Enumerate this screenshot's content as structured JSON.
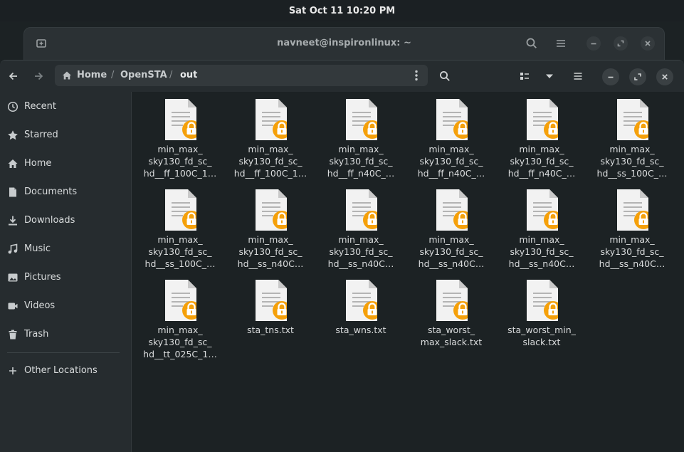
{
  "topbar": {
    "clock": "Sat Oct 11  10:20 PM"
  },
  "terminal": {
    "title": "navneet@inspironlinux: ~"
  },
  "pathbar": {
    "segments": [
      "Home",
      "OpenSTA",
      "out"
    ],
    "separator": "/"
  },
  "sidebar": {
    "items": [
      {
        "label": "Recent",
        "icon": "clock-icon"
      },
      {
        "label": "Starred",
        "icon": "star-icon"
      },
      {
        "label": "Home",
        "icon": "home-icon"
      },
      {
        "label": "Documents",
        "icon": "document-icon"
      },
      {
        "label": "Downloads",
        "icon": "download-icon"
      },
      {
        "label": "Music",
        "icon": "music-icon"
      },
      {
        "label": "Pictures",
        "icon": "picture-icon"
      },
      {
        "label": "Videos",
        "icon": "video-icon"
      },
      {
        "label": "Trash",
        "icon": "trash-icon"
      }
    ],
    "other_locations": "Other Locations"
  },
  "files": [
    {
      "lines": [
        "min_max_",
        "sky130_fd_sc_",
        "hd__ff_100C_1…"
      ]
    },
    {
      "lines": [
        "min_max_",
        "sky130_fd_sc_",
        "hd__ff_100C_1…"
      ]
    },
    {
      "lines": [
        "min_max_",
        "sky130_fd_sc_",
        "hd__ff_n40C_…"
      ]
    },
    {
      "lines": [
        "min_max_",
        "sky130_fd_sc_",
        "hd__ff_n40C_…"
      ]
    },
    {
      "lines": [
        "min_max_",
        "sky130_fd_sc_",
        "hd__ff_n40C_…"
      ]
    },
    {
      "lines": [
        "min_max_",
        "sky130_fd_sc_",
        "hd__ss_100C_…"
      ]
    },
    {
      "lines": [
        "min_max_",
        "sky130_fd_sc_",
        "hd__ss_100C_…"
      ]
    },
    {
      "lines": [
        "min_max_",
        "sky130_fd_sc_",
        "hd__ss_n40C…"
      ]
    },
    {
      "lines": [
        "min_max_",
        "sky130_fd_sc_",
        "hd__ss_n40C…"
      ]
    },
    {
      "lines": [
        "min_max_",
        "sky130_fd_sc_",
        "hd__ss_n40C…"
      ]
    },
    {
      "lines": [
        "min_max_",
        "sky130_fd_sc_",
        "hd__ss_n40C…"
      ]
    },
    {
      "lines": [
        "min_max_",
        "sky130_fd_sc_",
        "hd__ss_n40C…"
      ]
    },
    {
      "lines": [
        "min_max_",
        "sky130_fd_sc_",
        "hd__tt_025C_1…"
      ]
    },
    {
      "lines": [
        "sta_tns.txt"
      ]
    },
    {
      "lines": [
        "sta_wns.txt"
      ]
    },
    {
      "lines": [
        "sta_worst_",
        "max_slack.txt"
      ]
    },
    {
      "lines": [
        "sta_worst_min_",
        "slack.txt"
      ]
    }
  ],
  "colors": {
    "lock_badge": "#f5a00a",
    "doc_page": "#f2f2f2",
    "background": "#1c2224"
  }
}
